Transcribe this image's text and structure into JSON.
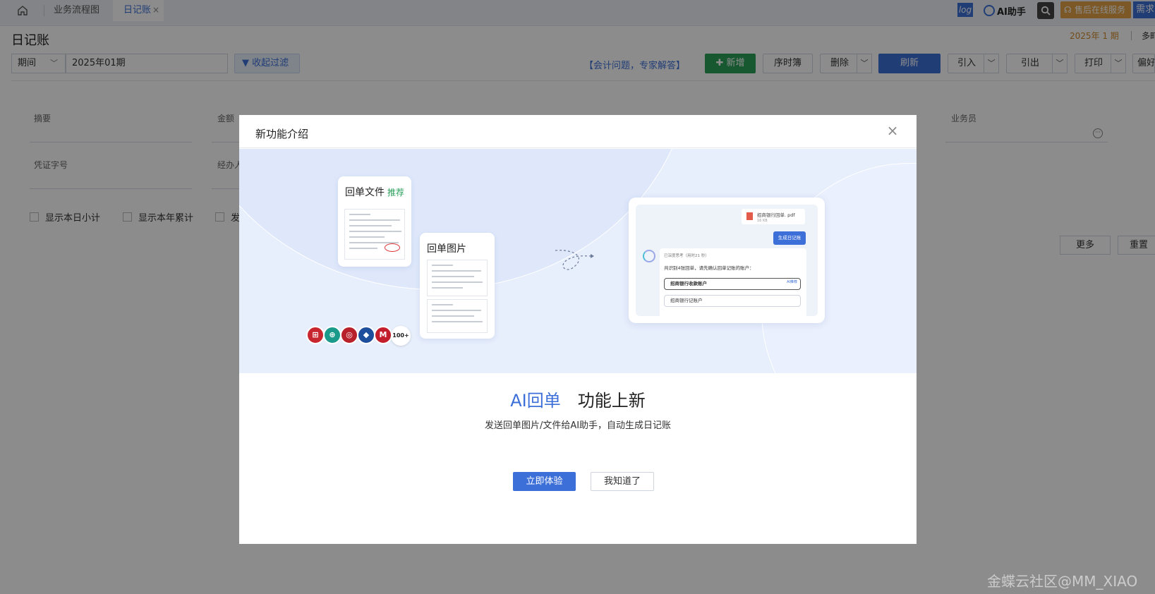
{
  "topbar": {
    "tabs": [
      {
        "label": "业务流程图"
      },
      {
        "label": "日记账",
        "close": "×"
      }
    ],
    "log_label": "log",
    "ai_label": "AI助手",
    "service_label": "售后在线服务",
    "request_label": "需求"
  },
  "page": {
    "title": "日记账",
    "current_period": "2025年 1 期",
    "mode_label": "多町"
  },
  "toolbar": {
    "period_select": "期间",
    "period_value": "2025年01期",
    "filter_button": "收起过滤",
    "expert_link": "【会计问题，专家解答】",
    "add_button": "新增",
    "sequence_button": "序时簿",
    "delete_button": "删除",
    "refresh_button": "刷新",
    "import_button": "引入",
    "export_button": "引出",
    "print_button": "打印",
    "prefs_button": "偏好"
  },
  "filters": {
    "summary": "摘要",
    "amount": "金额",
    "salesman": "业务员",
    "voucher_no": "凭证字号",
    "handler": "经办人",
    "show_daily_subtotal": "显示本日小计",
    "show_year_total": "显示本年累计",
    "show_third": "发",
    "more_button": "更多",
    "reset_button": "重置"
  },
  "modal": {
    "title": "新功能介绍",
    "close": "×",
    "receipt_file_title": "回单文件",
    "recommend_tag": "推荐",
    "receipt_image_title": "回单图片",
    "banks_more": "100+",
    "chat": {
      "file_name": "招商银行回单. pdf",
      "file_size": "16 KB",
      "generate_button": "生成日记账",
      "reply_header": "已深度思考（用时21 秒）",
      "reply_text": "共识别4张回单，请先确认回单记账的账户：",
      "account_1": "招商银行收款账户",
      "account_1_tag": "AI推荐",
      "account_2": "招商银行记账户"
    },
    "headline_ai": "AI回单",
    "headline_rest": "功能上新",
    "subline": "发送回单图片/文件给AI助手，自动生成日记账",
    "try_button": "立即体验",
    "ok_button": "我知道了"
  },
  "watermark": "金蝶云社区@MM_XIAO",
  "colors": {
    "primary": "#3c6fd8",
    "success": "#2aa05a",
    "warning": "#e0a044"
  }
}
